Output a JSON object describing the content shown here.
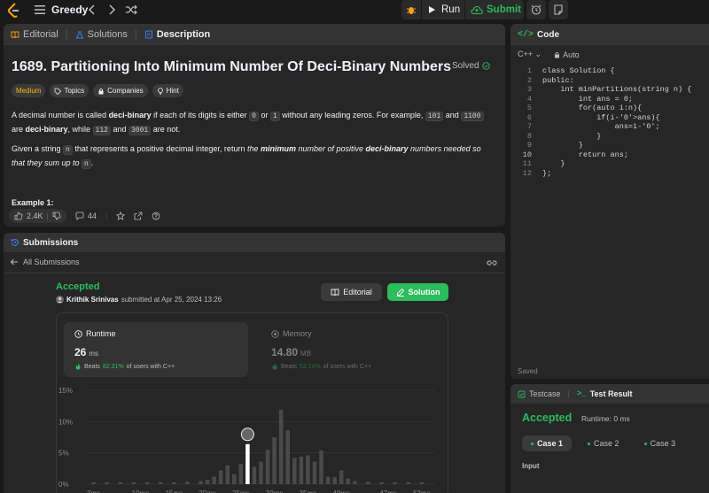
{
  "topbar": {
    "title": "Greedy",
    "run_label": "Run",
    "submit_label": "Submit"
  },
  "description_panel": {
    "tabs": [
      {
        "label": "Editorial",
        "icon": "book-icon"
      },
      {
        "label": "Solutions",
        "icon": "flask-icon"
      },
      {
        "label": "Description",
        "icon": "document-icon"
      }
    ],
    "title": "1689. Partitioning Into Minimum Number Of Deci-Binary Numbers",
    "solved_label": "Solved",
    "chips": {
      "difficulty": "Medium",
      "topics": "Topics",
      "companies": "Companies",
      "hint": "Hint"
    },
    "para1": {
      "a": "A decimal number is called ",
      "b": "deci-binary",
      "c": " if each of its digits is either ",
      "d": "0",
      "e": " or ",
      "f": "1",
      "g": " without any leading zeros. For example, ",
      "h": "101",
      "i": " and ",
      "j": "1100",
      "k": " are ",
      "l": "deci-binary",
      "m": ", while ",
      "n": "112",
      "o": " and ",
      "p": "3001",
      "q": " are not."
    },
    "para2": {
      "a": "Given a string ",
      "b": "n",
      "c": " that represents a positive decimal integer, return ",
      "d": "the ",
      "e": "minimum",
      "f": " number of positive ",
      "g": "deci-binary",
      "h": " numbers needed so that they sum up to ",
      "i": "n",
      "j": "."
    },
    "example_heading": "Example 1:",
    "footer": {
      "likes": "2.4K",
      "comments": "44"
    }
  },
  "submissions_panel": {
    "header": "Submissions",
    "back_label": "All Submissions",
    "status": "Accepted",
    "author": "Krithik Srinivas",
    "submitted_text": "submitted at Apr 25, 2024 13:26",
    "editorial_button": "Editorial",
    "solution_button": "Solution",
    "runtime": {
      "label": "Runtime",
      "value": "26",
      "unit": "ms",
      "beats_prefix": "Beats",
      "beats_pct": "82.31%",
      "beats_suffix": "of users with C++"
    },
    "memory": {
      "label": "Memory",
      "value": "14.80",
      "unit": "MB",
      "beats_prefix": "Beats",
      "beats_pct": "53.14%",
      "beats_suffix": "of users with C++"
    }
  },
  "chart_data": {
    "type": "bar",
    "y_ticks": [
      "15%",
      "10%",
      "5%",
      "0%"
    ],
    "ylim": [
      0,
      15
    ],
    "x_tick_labels": [
      "3ms",
      "10ms",
      "15ms",
      "20ms",
      "25ms",
      "30ms",
      "35ms",
      "40ms",
      "47ms",
      "52ms"
    ],
    "xlim": [
      2,
      54
    ],
    "bars": [
      {
        "x": 3,
        "y": 0.3
      },
      {
        "x": 5,
        "y": 0.3
      },
      {
        "x": 7,
        "y": 0.3
      },
      {
        "x": 9,
        "y": 0.3
      },
      {
        "x": 11,
        "y": 0.3
      },
      {
        "x": 13,
        "y": 0.3
      },
      {
        "x": 15,
        "y": 0.3
      },
      {
        "x": 17,
        "y": 0.4
      },
      {
        "x": 19,
        "y": 0.5
      },
      {
        "x": 20,
        "y": 0.7
      },
      {
        "x": 21,
        "y": 1.2
      },
      {
        "x": 22,
        "y": 2.2
      },
      {
        "x": 23,
        "y": 3.0
      },
      {
        "x": 24,
        "y": 1.6
      },
      {
        "x": 25,
        "y": 3.2
      },
      {
        "x": 26,
        "y": 6.4
      },
      {
        "x": 27,
        "y": 2.8
      },
      {
        "x": 28,
        "y": 3.6
      },
      {
        "x": 29,
        "y": 5.5
      },
      {
        "x": 30,
        "y": 7.5
      },
      {
        "x": 31,
        "y": 11.9
      },
      {
        "x": 32,
        "y": 8.6
      },
      {
        "x": 33,
        "y": 4.2
      },
      {
        "x": 34,
        "y": 4.4
      },
      {
        "x": 35,
        "y": 4.6
      },
      {
        "x": 36,
        "y": 3.6
      },
      {
        "x": 37,
        "y": 5.4
      },
      {
        "x": 38,
        "y": 1.2
      },
      {
        "x": 39,
        "y": 1.1
      },
      {
        "x": 40,
        "y": 2.2
      },
      {
        "x": 41,
        "y": 0.9
      },
      {
        "x": 42,
        "y": 0.5
      },
      {
        "x": 44,
        "y": 0.4
      },
      {
        "x": 46,
        "y": 0.3
      },
      {
        "x": 48,
        "y": 0.3
      },
      {
        "x": 50,
        "y": 0.3
      },
      {
        "x": 52,
        "y": 0.3
      }
    ],
    "highlight_x": 26
  },
  "code_panel": {
    "header": "Code",
    "language": "C++",
    "auto_label": "Auto",
    "lines": [
      "class Solution {",
      "public:",
      "    int minPartitions(string n) {",
      "        int ans = 0;",
      "        for(auto i:n){",
      "            if(i-'0'>ans){",
      "                ans=i-'0';",
      "            }",
      "        }",
      "        return ans;",
      "    }",
      "};"
    ],
    "line_numbers": [
      "1",
      "2",
      "3",
      "4",
      "5",
      "6",
      "7",
      "8",
      "9",
      "10",
      "11",
      "12"
    ],
    "saved_label": "Saved"
  },
  "test_panel": {
    "tabs": [
      {
        "label": "Testcase"
      },
      {
        "label": "Test Result"
      }
    ],
    "status": "Accepted",
    "runtime_text": "Runtime: 0 ms",
    "cases": [
      "Case 1",
      "Case 2",
      "Case 3"
    ],
    "input_label": "Input"
  },
  "colors": {
    "accent_green": "#2cbb5d",
    "medium_yellow": "#ffb800",
    "background": "#1a1a1a",
    "panel": "#262626"
  }
}
